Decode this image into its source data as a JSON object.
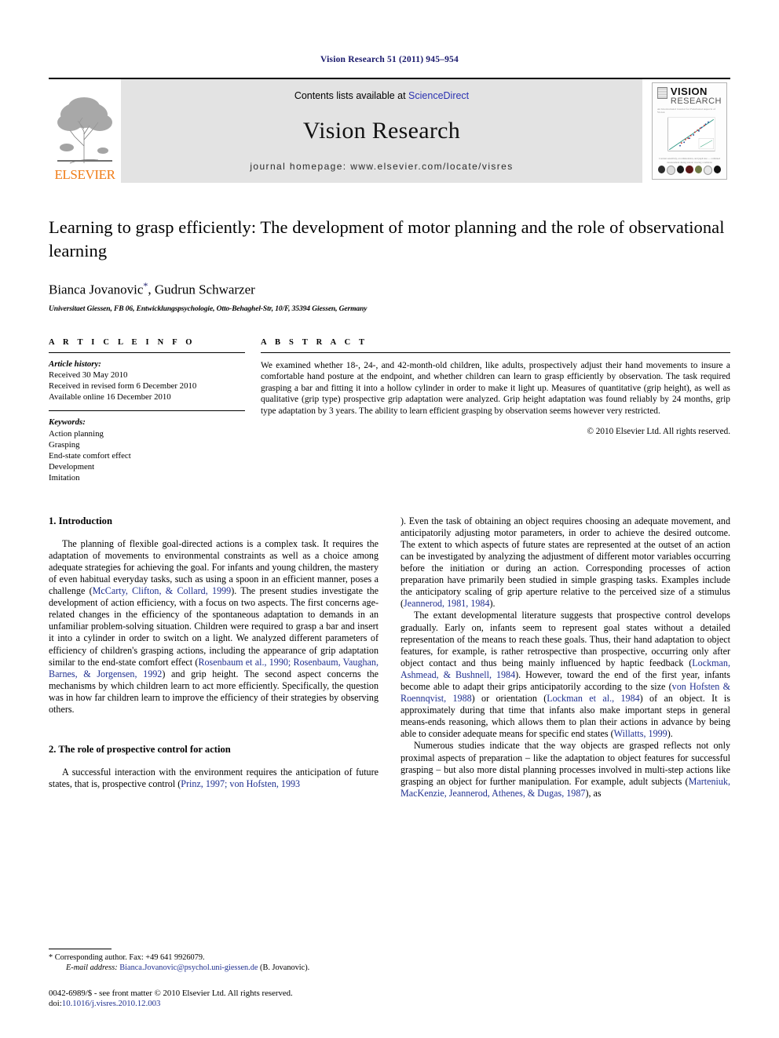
{
  "running_head": "Vision Research 51 (2011) 945–954",
  "masthead": {
    "publisher": "ELSEVIER",
    "contents_prefix": "Contents lists available at ",
    "contents_link": "ScienceDirect",
    "journal_title": "Vision Research",
    "homepage": "journal homepage: www.elsevier.com/locate/visres",
    "cover": {
      "line1": "VISION",
      "line2": "RESEARCH",
      "subtitle": "An International Journal for Functional Aspects of Vision",
      "caption": "Contrast sensitivity, accommodation, and pupil size — combined measurement during natural viewing conditions"
    }
  },
  "article": {
    "title": "Learning to grasp efficiently: The development of motor planning and the role of observational learning",
    "authors": "Bianca Jovanovic",
    "authors_tail": ", Gudrun Schwarzer",
    "corresponding_marker": "*",
    "affiliation": "Universitaet Giessen, FB 06, Entwicklungspsychologie, Otto-Behaghel-Str, 10/F, 35394 Giessen, Germany"
  },
  "info": {
    "heading": "A R T I C L E   I N F O",
    "history_label": "Article history:",
    "history": [
      "Received 30 May 2010",
      "Received in revised form 6 December 2010",
      "Available online 16 December 2010"
    ],
    "keywords_label": "Keywords:",
    "keywords": [
      "Action planning",
      "Grasping",
      "End-state comfort effect",
      "Development",
      "Imitation"
    ]
  },
  "abstract": {
    "heading": "A B S T R A C T",
    "text": "We examined whether 18-, 24-, and 42-month-old children, like adults, prospectively adjust their hand movements to insure a comfortable hand posture at the endpoint, and whether children can learn to grasp efficiently by observation. The task required grasping a bar and fitting it into a hollow cylinder in order to make it light up. Measures of quantitative (grip height), as well as qualitative (grip type) prospective grip adaptation were analyzed. Grip height adaptation was found reliably by 24 months, grip type adaptation by 3 years. The ability to learn efficient grasping by observation seems however very restricted.",
    "copyright": "© 2010 Elsevier Ltd. All rights reserved."
  },
  "sections": {
    "intro_heading": "1. Introduction",
    "intro_p1_a": "The planning of flexible goal-directed actions is a complex task. It requires the adaptation of movements to environmental constraints as well as a choice among adequate strategies for achieving the goal. For infants and young children, the mastery of even habitual everyday tasks, such as using a spoon in an efficient manner, poses a challenge (",
    "intro_cite1": "McCarty, Clifton, & Collard, 1999",
    "intro_p1_b": "). The present studies investigate the development of action efficiency, with a focus on two aspects. The first concerns age-related changes in the efficiency of the spontaneous adaptation to demands in an unfamiliar problem-solving situation. Children were required to grasp a bar and insert it into a cylinder in order to switch on a light. We analyzed different parameters of efficiency of children's grasping actions, including the appearance of grip adaptation similar to the end-state comfort effect (",
    "intro_cite2": "Rosenbaum et al., 1990; Rosenbaum, Vaughan, Barnes, & Jorgensen, 1992",
    "intro_p1_c": ") and grip height. The second aspect concerns the mechanisms by which children learn to act more efficiently. Specifically, the question was in how far children learn to improve the efficiency of their strategies by observing others.",
    "prospective_heading": "2. The role of prospective control for action",
    "prosp_p1_a": "A successful interaction with the environment requires the anticipation of future states, that is, prospective control (",
    "prosp_cite1": "Prinz, 1997; von Hofsten, 1993",
    "prosp_p1_b": "). Even the task of obtaining an object requires choosing an adequate movement, and anticipatorily adjusting motor parameters, in order to achieve the desired outcome. The extent to which aspects of future states are represented at the outset of an action can be investigated by analyzing the adjustment of different motor variables occurring before the initiation or during an action. Corresponding processes of action preparation have primarily been studied in simple grasping tasks. Examples include the anticipatory scaling of grip aperture relative to the perceived size of a stimulus (",
    "prosp_cite2": "Jeannerod, 1981, 1984",
    "prosp_p1_c": ").",
    "prosp_p2_a": "The extant developmental literature suggests that prospective control develops gradually. Early on, infants seem to represent goal states without a detailed representation of the means to reach these goals. Thus, their hand adaptation to object features, for example, is rather retrospective than prospective, occurring only after object contact and thus being mainly influenced by haptic feedback (",
    "prosp_p2_cite1": "Lockman, Ashmead, & Bushnell, 1984",
    "prosp_p2_b": "). However, toward the end of the first year, infants become able to adapt their grips anticipatorily according to the size (",
    "prosp_p2_cite2": "von Hofsten & Roennqvist, 1988",
    "prosp_p2_c": ") or orientation (",
    "prosp_p2_cite3": "Lockman et al., 1984",
    "prosp_p2_d": ") of an object. It is approximately during that time that infants also make important steps in general means-ends reasoning, which allows them to plan their actions in advance by being able to consider adequate means for specific end states (",
    "prosp_p2_cite4": "Willatts, 1999",
    "prosp_p2_e": ").",
    "prosp_p3_a": "Numerous studies indicate that the way objects are grasped reflects not only proximal aspects of preparation – like the adaptation to object features for successful grasping – but also more distal planning processes involved in multi-step actions like grasping an object for further manipulation. For example, adult subjects (",
    "prosp_p3_cite1": "Marteniuk, MacKenzie, Jeannerod, Athenes, & Dugas, 1987",
    "prosp_p3_b": "), as"
  },
  "footnotes": {
    "corresponding": "* Corresponding author. Fax: +49 641 9926079.",
    "email_label": "E-mail address:",
    "email": "Bianca.Jovanovic@psychol.uni-giessen.de",
    "email_tail": " (B. Jovanovic).",
    "issn_line": "0042-6989/$ - see front matter © 2010 Elsevier Ltd. All rights reserved.",
    "doi_label": "doi:",
    "doi": "10.1016/j.visres.2010.12.003"
  },
  "colors": {
    "link": "#2b32b2",
    "cite": "#1f2f8f",
    "running_head": "#17176b",
    "elsevier_orange": "#f07c16",
    "masthead_bg": "#e3e3e3"
  }
}
